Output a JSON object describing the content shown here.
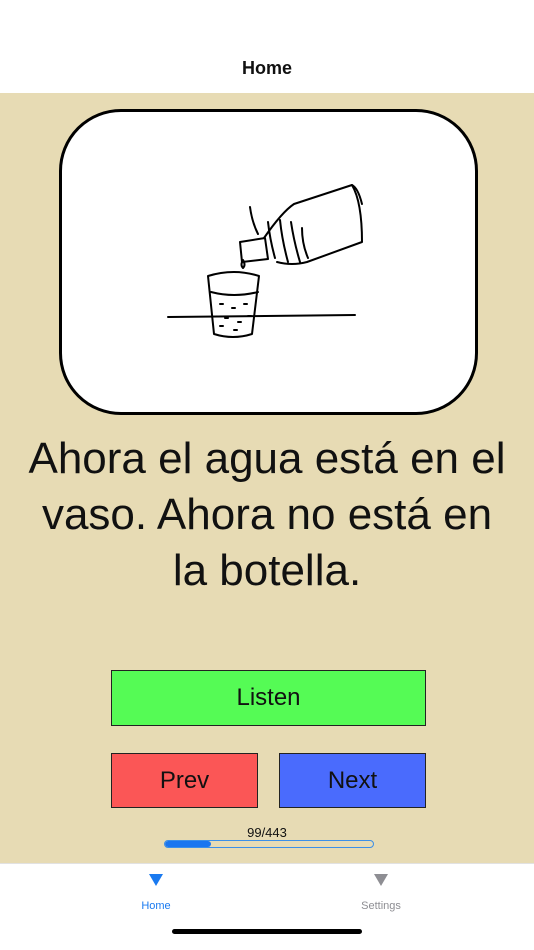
{
  "nav": {
    "title": "Home"
  },
  "card": {
    "illustration": "water-pouring-from-bottle-into-glass"
  },
  "sentence": "Ahora el agua está en el vaso. Ahora no está en la botella.",
  "buttons": {
    "listen": "Listen",
    "prev": "Prev",
    "next": "Next"
  },
  "progress": {
    "label": "99/443",
    "current": 99,
    "total": 443
  },
  "tabs": [
    {
      "label": "Home",
      "icon": "triangle-down-icon",
      "active": true
    },
    {
      "label": "Settings",
      "icon": "triangle-down-icon",
      "active": false
    }
  ],
  "colors": {
    "background": "#e7dbb4",
    "listen": "#55fb55",
    "prev": "#fb5656",
    "next": "#4a6bfd",
    "accent": "#1a7af0"
  }
}
